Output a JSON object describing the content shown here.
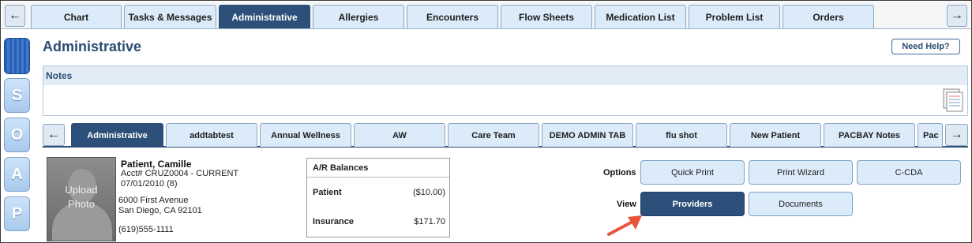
{
  "top_tabs": [
    "Chart",
    "Tasks & Messages",
    "Administrative",
    "Allergies",
    "Encounters",
    "Flow Sheets",
    "Medication List",
    "Problem List",
    "Orders"
  ],
  "top_tabs_active": "Administrative",
  "nav": {
    "prev": "←",
    "next": "→"
  },
  "rail": {
    "s": "S",
    "o": "O",
    "a": "A",
    "p": "P"
  },
  "page_title": "Administrative",
  "help_label": "Need Help?",
  "notes": {
    "title": "Notes"
  },
  "sub_tabs": [
    "Administrative",
    "addtabtest",
    "Annual Wellness",
    "AW",
    "Care Team",
    "DEMO ADMIN TAB",
    "flu shot",
    "New Patient",
    "PACBAY Notes",
    "Pac"
  ],
  "patient": {
    "photo_line1": "Upload",
    "photo_line2": "Photo",
    "name": "Patient, Camille",
    "acct": "Acct# CRUZ0004 - CURRENT",
    "dob": "07/01/2010 (8)",
    "address1": "6000 First Avenue",
    "address2": "San Diego, CA 92101",
    "phone": "(619)555-1111"
  },
  "ar_balances": {
    "title": "A/R Balances",
    "patient_label": "Patient",
    "patient_value": "($10.00)",
    "insurance_label": "Insurance",
    "insurance_value": "$171.70"
  },
  "options": {
    "label": "Options",
    "quick_print": "Quick Print",
    "print_wizard": "Print Wizard",
    "ccda": "C-CDA"
  },
  "view": {
    "label": "View",
    "providers": "Providers",
    "documents": "Documents"
  },
  "colors": {
    "active_tab": "#2c5079",
    "tab_bg": "#dcebf9",
    "title": "#2c4d73",
    "annotation_arrow": "#e8553c"
  }
}
